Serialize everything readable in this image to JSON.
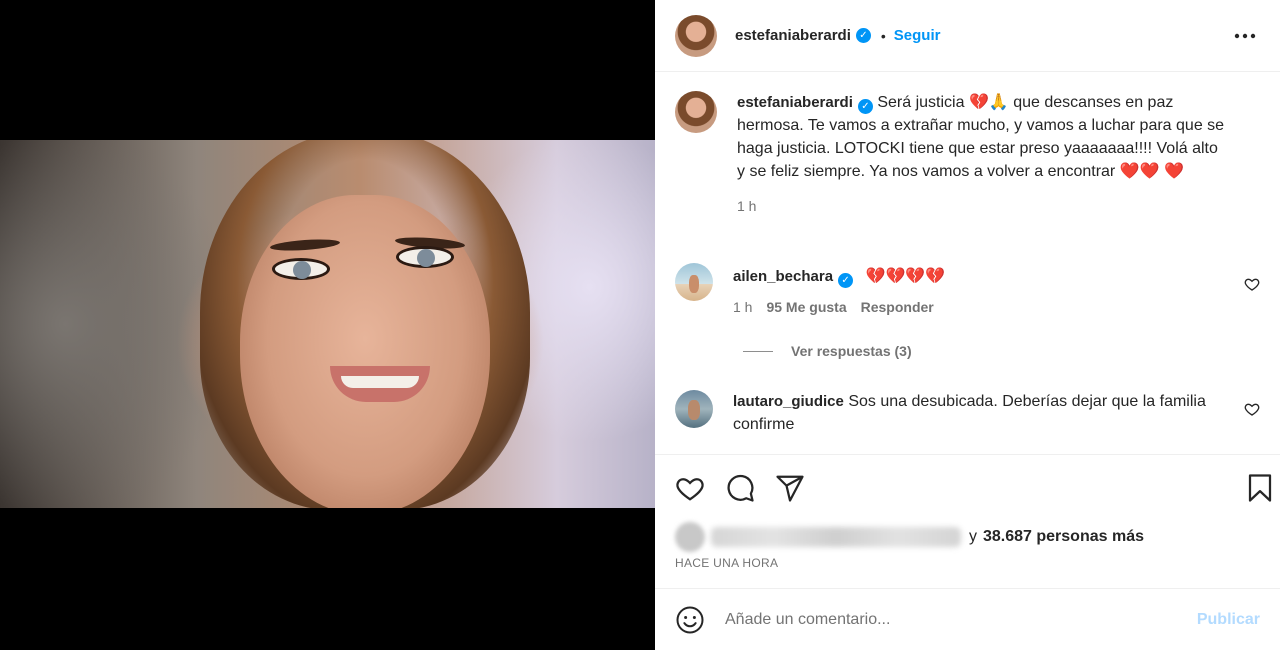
{
  "post": {
    "author": "estefaniaberardi",
    "verified_glyph": "✓",
    "dot": "•",
    "follow_label": "Seguir",
    "more_label": "•••"
  },
  "caption": {
    "author": "estefaniaberardi",
    "text": "Será justicia 💔🙏 que descanses en paz hermosa. Te vamos a extrañar mucho, y vamos a luchar para que se haga justicia. LOTOCKI tiene que estar preso yaaaaaaa!!!! Volá alto y se feliz siempre. Ya nos vamos a volver a encontrar ❤️❤️ ❤️",
    "time": "1 h"
  },
  "comments": [
    {
      "author": "ailen_bechara",
      "verified": true,
      "text": "💔💔💔💔",
      "time": "1 h",
      "likes": "95 Me gusta",
      "reply": "Responder",
      "view_replies": "Ver respuestas (3)"
    },
    {
      "author": "lautaro_giudice",
      "verified": false,
      "text": "Sos una desubicada. Deberías dejar que la familia confirme"
    }
  ],
  "likes": {
    "and_text": "y",
    "count_text": "38.687 personas más"
  },
  "timestamp": "HACE UNA HORA",
  "add_comment": {
    "placeholder": "Añade un comentario...",
    "post_label": "Publicar"
  },
  "icons": {
    "like": "heart-icon",
    "comment": "comment-icon",
    "share": "share-icon",
    "save": "bookmark-icon",
    "emoji": "emoji-icon",
    "more": "more-icon"
  },
  "colors": {
    "accent": "#0095f6",
    "publish_disabled": "#b3dbff",
    "text": "#262626",
    "muted": "#737373"
  }
}
